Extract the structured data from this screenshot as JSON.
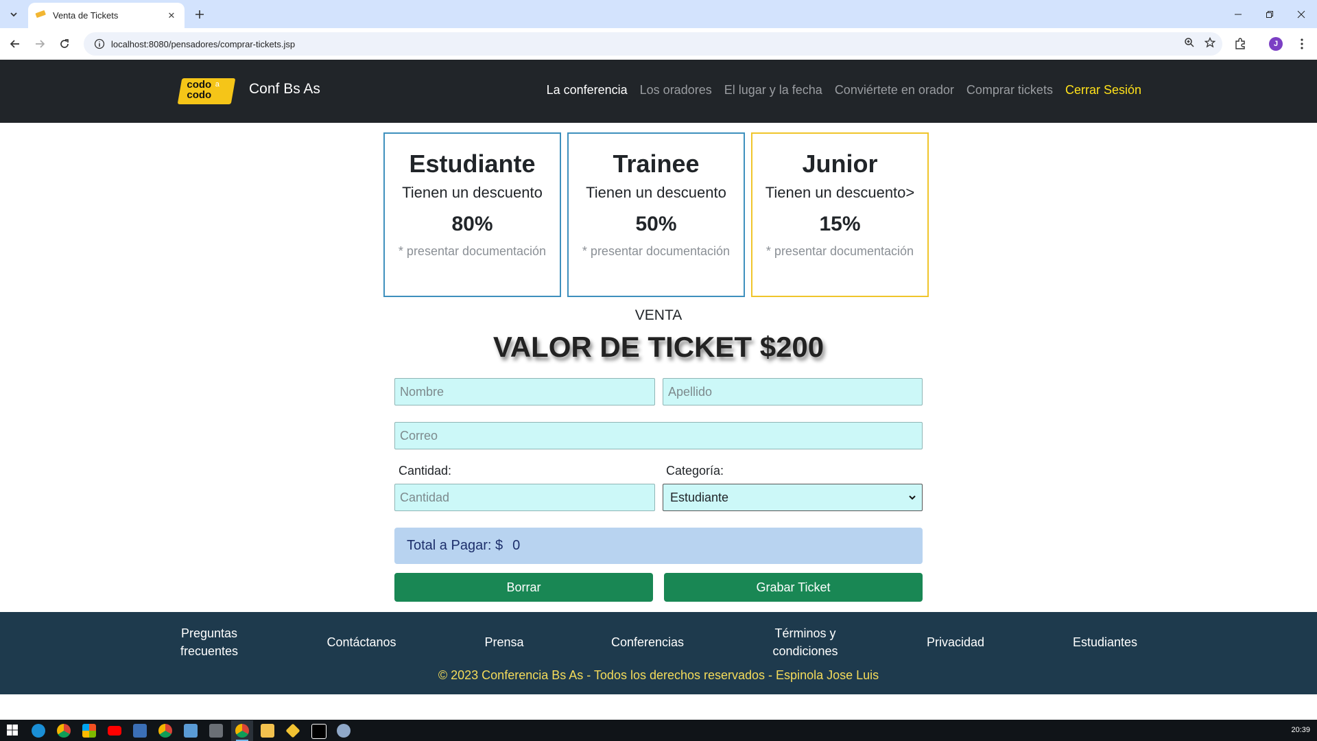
{
  "browser": {
    "tab_title": "Venta de Tickets",
    "tab_close": "✕",
    "new_tab": "+",
    "url": "localhost:8080/pensadores/comprar-tickets.jsp",
    "profile_initial": "J"
  },
  "site": {
    "logo_line1": "codo",
    "logo_line2": "codo",
    "logo_accent": "a",
    "brand": "Conf Bs As",
    "nav": [
      {
        "label": "La conferencia"
      },
      {
        "label": "Los oradores"
      },
      {
        "label": "El lugar y la fecha"
      },
      {
        "label": "Conviértete en orador"
      },
      {
        "label": "Comprar tickets"
      },
      {
        "label": "Cerrar Sesión"
      }
    ]
  },
  "cards": [
    {
      "title": "Estudiante",
      "subtitle": "Tienen un descuento",
      "percent": "80%",
      "note": "* presentar documentación",
      "border_color": "#3d8fbd"
    },
    {
      "title": "Trainee",
      "subtitle": "Tienen un descuento",
      "percent": "50%",
      "note": "* presentar documentación",
      "border_color": "#3d8fbd"
    },
    {
      "title": "Junior",
      "subtitle": "Tienen un descuento>",
      "percent": "15%",
      "note": "* presentar documentación",
      "border_color": "#f0c52a"
    }
  ],
  "form": {
    "venta_label": "VENTA",
    "ticket_value": "VALOR DE TICKET $200",
    "nombre_placeholder": "Nombre",
    "apellido_placeholder": "Apellido",
    "correo_placeholder": "Correo",
    "cantidad_label": "Cantidad:",
    "cantidad_placeholder": "Cantidad",
    "categoria_label": "Categoría:",
    "categoria_selected": "Estudiante",
    "total_label": "Total a Pagar: $",
    "total_value": "0",
    "borrar_label": "Borrar",
    "grabar_label": "Grabar Ticket"
  },
  "footer": {
    "links": [
      {
        "line1": "Preguntas",
        "line2": "frecuentes"
      },
      {
        "line1": "Contáctanos",
        "line2": ""
      },
      {
        "line1": "Prensa",
        "line2": ""
      },
      {
        "line1": "Conferencias",
        "line2": ""
      },
      {
        "line1": "Términos y",
        "line2": "condiciones"
      },
      {
        "line1": "Privacidad",
        "line2": ""
      },
      {
        "line1": "Estudiantes",
        "line2": ""
      }
    ],
    "copyright": "© 2023 Conferencia Bs As - Todos los derechos reservados - Espinola Jose Luis"
  },
  "taskbar": {
    "clock": "20:39",
    "apps": [
      "windows-start-icon",
      "edge-icon",
      "chrome-icon",
      "apps-icon",
      "youtube-icon",
      "vscode-icon",
      "chrome-icon",
      "rdp-icon",
      "calculator-icon",
      "chrome-icon",
      "file-explorer-icon",
      "git-icon",
      "intellij-icon",
      "app-icon"
    ]
  },
  "colors": {
    "navbar_bg": "#212529",
    "accent_yellow": "#ffe11a",
    "field_bg": "#ccf8f8",
    "total_bg": "#b8d3f0",
    "button_green": "#198754",
    "footer_bg": "#1e3a4d"
  }
}
